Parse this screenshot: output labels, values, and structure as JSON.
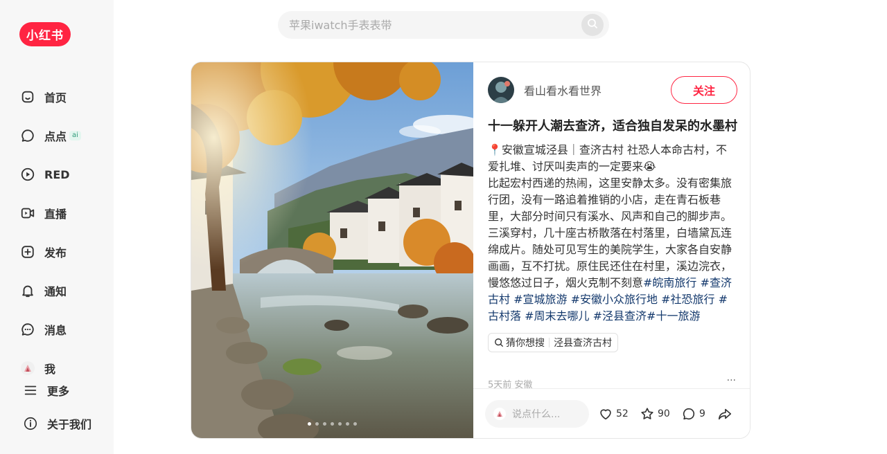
{
  "brand": {
    "logo_text": "小红书",
    "accent": "#ff2442"
  },
  "sidebar": {
    "items": [
      {
        "label": "首页",
        "icon": "home-icon"
      },
      {
        "label": "点点",
        "icon": "chat-bubble-icon",
        "badge": "ai"
      },
      {
        "label": "RED",
        "icon": "play-circle-icon"
      },
      {
        "label": "直播",
        "icon": "live-camera-icon"
      },
      {
        "label": "发布",
        "icon": "plus-square-icon"
      },
      {
        "label": "通知",
        "icon": "bell-icon"
      },
      {
        "label": "消息",
        "icon": "message-icon"
      },
      {
        "label": "我",
        "icon": "avatar-icon"
      }
    ],
    "more_label": "更多",
    "about_label": "关于我们"
  },
  "search": {
    "placeholder": "苹果iwatch手表表带"
  },
  "note": {
    "author": "看山看水看世界",
    "follow_label": "关注",
    "title": "十一躲开人潮去查济，适合独自发呆的水墨村",
    "desc_parts": [
      "📍安徽宣城泾县｜查济古村 社恐人本命古村，不爱扎堆、讨厌叫卖声的一定要来😭",
      "比起宏村西递的热闹，这里安静太多。没有密集旅行团，没有一路追着推销的小店，走在青石板巷里，大部分时间只有溪水、风声和自己的脚步声。三溪穿村，几十座古桥散落在村落里，白墙黛瓦连绵成片。随处可见写生的美院学生，大家各自安静画画，互不打扰。原住民还住在村里，溪边浣衣，慢悠悠过日子，烟火克制不刻意"
    ],
    "tags": [
      "#皖南旅行",
      "#查济古村",
      "#宣城旅游",
      "#安徽小众旅行地",
      "#社恐旅行",
      "#古村落",
      "#周末去哪儿",
      "#泾县查济",
      "#十一旅游"
    ],
    "guess_label": "猜你想搜",
    "guess_query": "泾县查济古村",
    "meta": "5天前 安徽",
    "more_glyph": "···",
    "image_count": 7,
    "image_index": 1
  },
  "engage": {
    "comment_placeholder": "说点什么...",
    "likes": "52",
    "collects": "90",
    "comments": "9"
  }
}
